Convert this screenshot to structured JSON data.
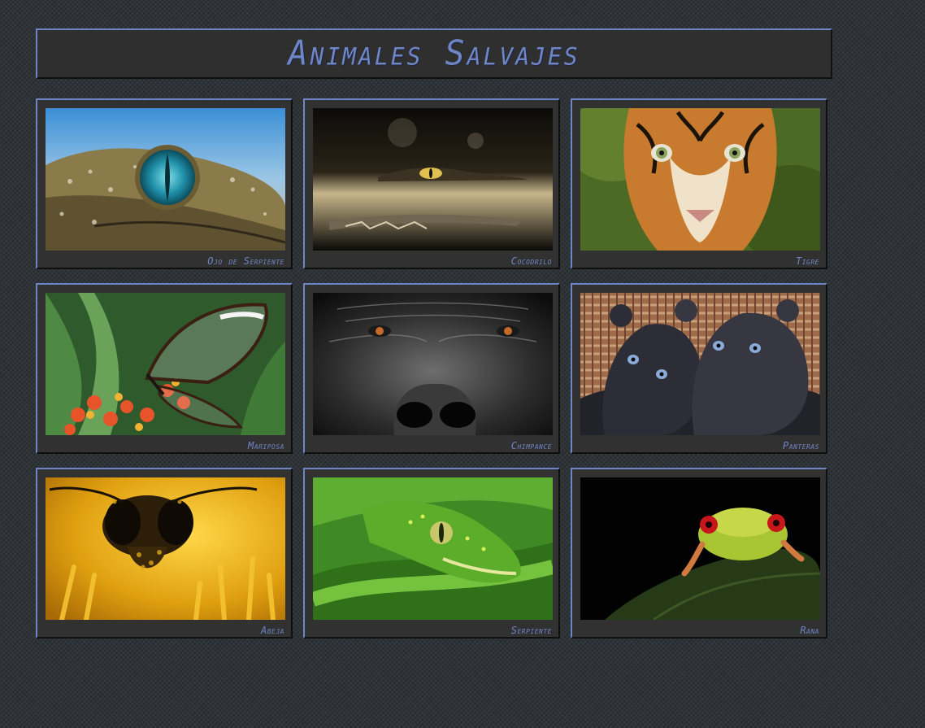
{
  "page": {
    "title": "Animales Salvajes"
  },
  "theme": {
    "accent": "#6f86c6",
    "panel": "#313131",
    "background": "#2e3338"
  },
  "gallery": {
    "items": [
      {
        "caption": "Ojo de Serpiente",
        "image": "gecko-eye-photo"
      },
      {
        "caption": "Cocodrilo",
        "image": "crocodile-photo"
      },
      {
        "caption": "Tigre",
        "image": "tiger-photo"
      },
      {
        "caption": "Mariposa",
        "image": "butterfly-photo"
      },
      {
        "caption": "Chimpance",
        "image": "gorilla-photo"
      },
      {
        "caption": "Panteras",
        "image": "panther-cubs-photo"
      },
      {
        "caption": "Abeja",
        "image": "bee-photo"
      },
      {
        "caption": "Serpiente",
        "image": "green-snake-photo"
      },
      {
        "caption": "Rana",
        "image": "frog-photo"
      }
    ]
  }
}
